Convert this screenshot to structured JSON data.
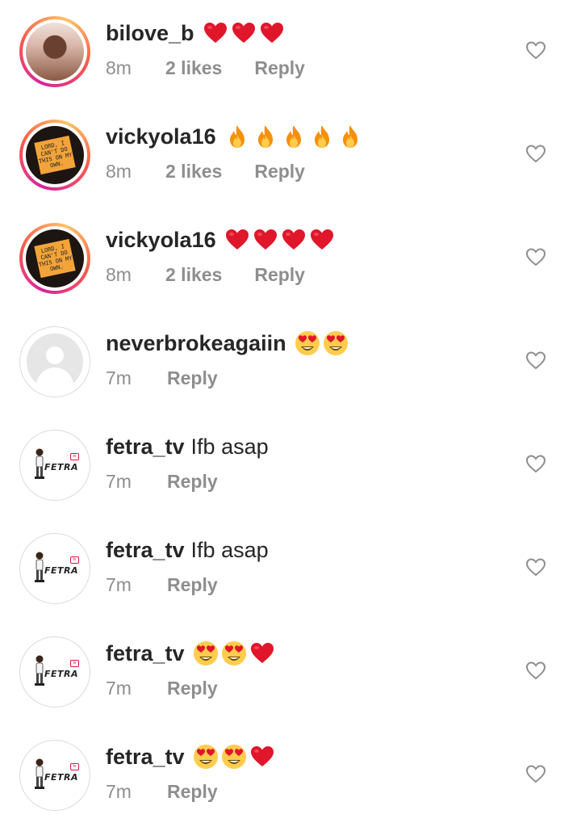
{
  "comments": [
    {
      "username": "bilove_b",
      "text": "",
      "emojis": [
        "heart",
        "heart",
        "heart"
      ],
      "time": "8m",
      "likes": "2 likes",
      "reply": "Reply",
      "avatar": "blonde",
      "story": true,
      "like_icon": "heart-outline-icon"
    },
    {
      "username": "vickyola16",
      "text": "",
      "emojis": [
        "fire",
        "fire",
        "fire",
        "fire",
        "fire"
      ],
      "time": "8m",
      "likes": "2 likes",
      "reply": "Reply",
      "avatar": "note",
      "story": true,
      "like_icon": "heart-outline-icon"
    },
    {
      "username": "vickyola16",
      "text": "",
      "emojis": [
        "heart",
        "heart",
        "heart",
        "heart"
      ],
      "time": "8m",
      "likes": "2 likes",
      "reply": "Reply",
      "avatar": "note",
      "story": true,
      "like_icon": "heart-outline-icon"
    },
    {
      "username": "neverbrokeagaiin",
      "text": "",
      "emojis": [
        "heart-eyes",
        "heart-eyes"
      ],
      "time": "7m",
      "likes": "",
      "reply": "Reply",
      "avatar": "default",
      "story": false,
      "like_icon": "heart-outline-icon"
    },
    {
      "username": "fetra_tv",
      "text": "Ifb asap",
      "emojis": [],
      "time": "7m",
      "likes": "",
      "reply": "Reply",
      "avatar": "fetra",
      "story": false,
      "like_icon": "heart-outline-icon"
    },
    {
      "username": "fetra_tv",
      "text": "Ifb asap",
      "emojis": [],
      "time": "7m",
      "likes": "",
      "reply": "Reply",
      "avatar": "fetra",
      "story": false,
      "like_icon": "heart-outline-icon"
    },
    {
      "username": "fetra_tv",
      "text": "",
      "emojis": [
        "heart-eyes",
        "heart-eyes",
        "heart"
      ],
      "time": "7m",
      "likes": "",
      "reply": "Reply",
      "avatar": "fetra",
      "story": false,
      "like_icon": "heart-outline-icon"
    },
    {
      "username": "fetra_tv",
      "text": "",
      "emojis": [
        "heart-eyes",
        "heart-eyes",
        "heart"
      ],
      "time": "7m",
      "likes": "",
      "reply": "Reply",
      "avatar": "fetra",
      "story": false,
      "like_icon": "heart-outline-icon"
    }
  ],
  "avatar_note_text": "LORD, I CAN'T DO THIS ON MY OWN.",
  "avatar_fetra_text": "FETRA",
  "avatar_fetra_badge": "tv",
  "colors": {
    "text": "#262626",
    "meta": "#8e8e8e",
    "heart": "#e0162b",
    "story_ring_start": "#d6249f",
    "story_ring_end": "#fdc468"
  }
}
